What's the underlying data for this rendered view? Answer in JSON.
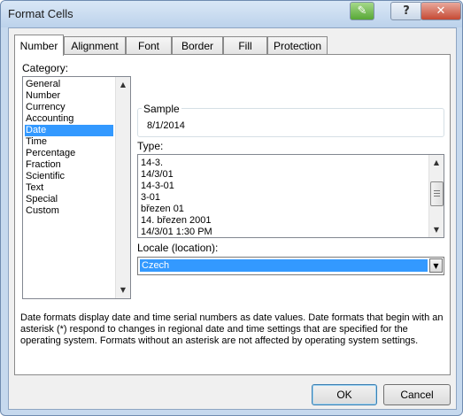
{
  "window": {
    "title": "Format Cells"
  },
  "title_buttons": {
    "ink": "✎",
    "help": "?",
    "close": "✕"
  },
  "tabs": [
    "Number",
    "Alignment",
    "Font",
    "Border",
    "Fill",
    "Protection"
  ],
  "active_tab": "Number",
  "category": {
    "label": "Category:",
    "items": [
      "General",
      "Number",
      "Currency",
      "Accounting",
      "Date",
      "Time",
      "Percentage",
      "Fraction",
      "Scientific",
      "Text",
      "Special",
      "Custom"
    ],
    "selected": "Date"
  },
  "sample": {
    "label": "Sample",
    "value": "8/1/2014"
  },
  "type": {
    "label": "Type:",
    "items": [
      "14-3.",
      "14/3/01",
      "14-3-01",
      "3-01",
      "březen 01",
      "14. březen 2001",
      "14/3/01 1:30 PM"
    ]
  },
  "locale": {
    "label": "Locale (location):",
    "value": "Czech"
  },
  "description": "Date formats display date and time serial numbers as date values.  Date formats that begin with an asterisk (*) respond to changes in regional date and time settings that are specified for the operating system. Formats without an asterisk are not affected by operating system settings.",
  "buttons": {
    "ok": "OK",
    "cancel": "Cancel"
  },
  "colors": {
    "selection": "#3399ff",
    "titlebar": "#c6d9ee"
  }
}
